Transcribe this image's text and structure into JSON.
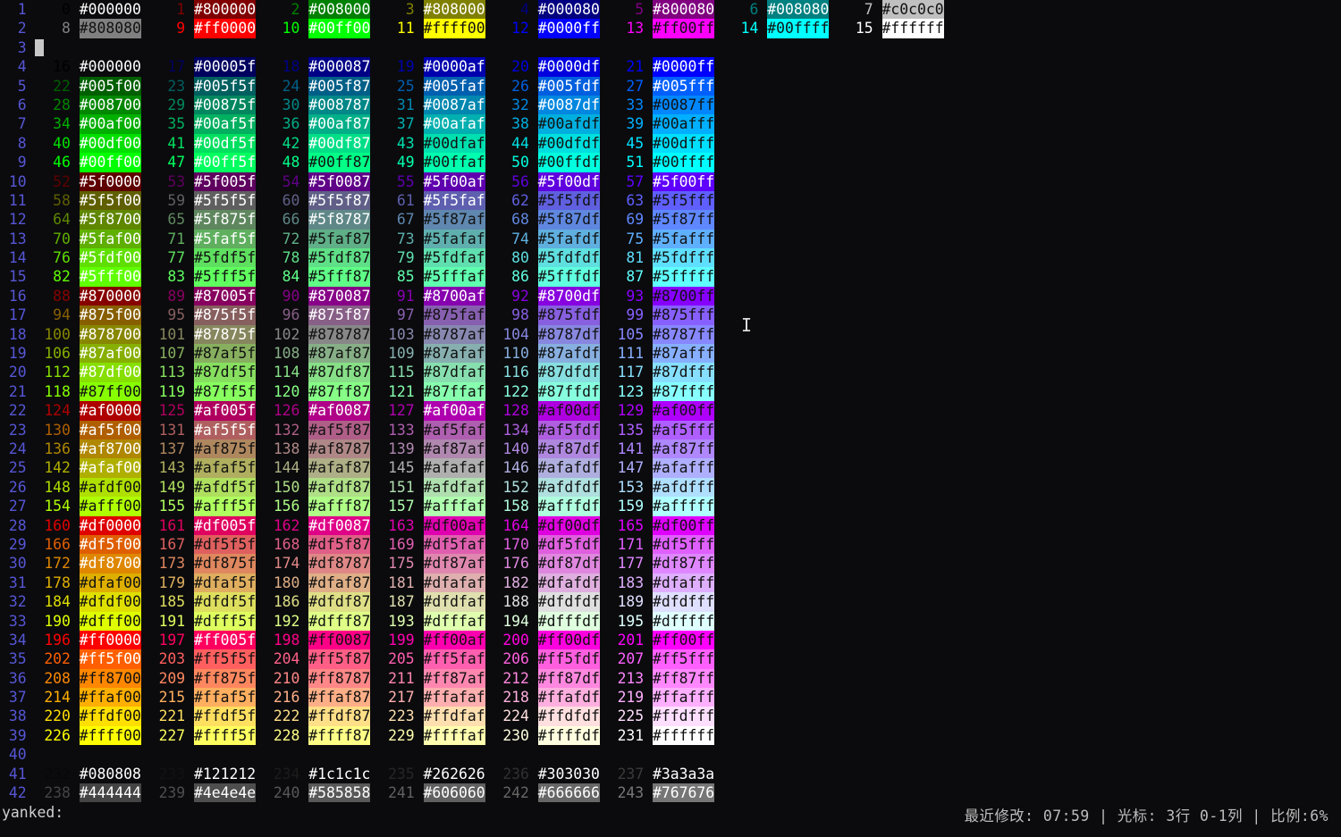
{
  "lines": [
    {
      "n": "1",
      "idx": [
        "0",
        "1",
        "2",
        "3",
        "4",
        "5",
        "6",
        "7"
      ],
      "hex": [
        "#000000",
        "#800000",
        "#008000",
        "#808000",
        "#000080",
        "#800080",
        "#008080",
        "#c0c0c0"
      ]
    },
    {
      "n": "2",
      "idx": [
        "8",
        "9",
        "10",
        "11",
        "12",
        "13",
        "14",
        "15"
      ],
      "hex": [
        "#808080",
        "#ff0000",
        "#00ff00",
        "#ffff00",
        "#0000ff",
        "#ff00ff",
        "#00ffff",
        "#ffffff"
      ]
    },
    {
      "n": "3",
      "idx": [],
      "hex": [],
      "cursor": true
    },
    {
      "n": "4",
      "idx": [
        "16",
        "17",
        "18",
        "19",
        "20",
        "21"
      ],
      "hex": [
        "#000000",
        "#00005f",
        "#000087",
        "#0000af",
        "#0000df",
        "#0000ff"
      ]
    },
    {
      "n": "5",
      "idx": [
        "22",
        "23",
        "24",
        "25",
        "26",
        "27"
      ],
      "hex": [
        "#005f00",
        "#005f5f",
        "#005f87",
        "#005faf",
        "#005fdf",
        "#005fff"
      ]
    },
    {
      "n": "6",
      "idx": [
        "28",
        "29",
        "30",
        "31",
        "32",
        "33"
      ],
      "hex": [
        "#008700",
        "#00875f",
        "#008787",
        "#0087af",
        "#0087df",
        "#0087ff"
      ]
    },
    {
      "n": "7",
      "idx": [
        "34",
        "35",
        "36",
        "37",
        "38",
        "39"
      ],
      "hex": [
        "#00af00",
        "#00af5f",
        "#00af87",
        "#00afaf",
        "#00afdf",
        "#00afff"
      ]
    },
    {
      "n": "8",
      "idx": [
        "40",
        "41",
        "42",
        "43",
        "44",
        "45"
      ],
      "hex": [
        "#00df00",
        "#00df5f",
        "#00df87",
        "#00dfaf",
        "#00dfdf",
        "#00dfff"
      ]
    },
    {
      "n": "9",
      "idx": [
        "46",
        "47",
        "48",
        "49",
        "50",
        "51"
      ],
      "hex": [
        "#00ff00",
        "#00ff5f",
        "#00ff87",
        "#00ffaf",
        "#00ffdf",
        "#00ffff"
      ]
    },
    {
      "n": "10",
      "idx": [
        "52",
        "53",
        "54",
        "55",
        "56",
        "57"
      ],
      "hex": [
        "#5f0000",
        "#5f005f",
        "#5f0087",
        "#5f00af",
        "#5f00df",
        "#5f00ff"
      ]
    },
    {
      "n": "11",
      "idx": [
        "58",
        "59",
        "60",
        "61",
        "62",
        "63"
      ],
      "hex": [
        "#5f5f00",
        "#5f5f5f",
        "#5f5f87",
        "#5f5faf",
        "#5f5fdf",
        "#5f5fff"
      ]
    },
    {
      "n": "12",
      "idx": [
        "64",
        "65",
        "66",
        "67",
        "68",
        "69"
      ],
      "hex": [
        "#5f8700",
        "#5f875f",
        "#5f8787",
        "#5f87af",
        "#5f87df",
        "#5f87ff"
      ]
    },
    {
      "n": "13",
      "idx": [
        "70",
        "71",
        "72",
        "73",
        "74",
        "75"
      ],
      "hex": [
        "#5faf00",
        "#5faf5f",
        "#5faf87",
        "#5fafaf",
        "#5fafdf",
        "#5fafff"
      ]
    },
    {
      "n": "14",
      "idx": [
        "76",
        "77",
        "78",
        "79",
        "80",
        "81"
      ],
      "hex": [
        "#5fdf00",
        "#5fdf5f",
        "#5fdf87",
        "#5fdfaf",
        "#5fdfdf",
        "#5fdfff"
      ]
    },
    {
      "n": "15",
      "idx": [
        "82",
        "83",
        "84",
        "85",
        "86",
        "87"
      ],
      "hex": [
        "#5fff00",
        "#5fff5f",
        "#5fff87",
        "#5fffaf",
        "#5fffdf",
        "#5fffff"
      ]
    },
    {
      "n": "16",
      "idx": [
        "88",
        "89",
        "90",
        "91",
        "92",
        "93"
      ],
      "hex": [
        "#870000",
        "#87005f",
        "#870087",
        "#8700af",
        "#8700df",
        "#8700ff"
      ]
    },
    {
      "n": "17",
      "idx": [
        "94",
        "95",
        "96",
        "97",
        "98",
        "99"
      ],
      "hex": [
        "#875f00",
        "#875f5f",
        "#875f87",
        "#875faf",
        "#875fdf",
        "#875fff"
      ]
    },
    {
      "n": "18",
      "idx": [
        "100",
        "101",
        "102",
        "103",
        "104",
        "105"
      ],
      "hex": [
        "#878700",
        "#87875f",
        "#878787",
        "#8787af",
        "#8787df",
        "#8787ff"
      ]
    },
    {
      "n": "19",
      "idx": [
        "106",
        "107",
        "108",
        "109",
        "110",
        "111"
      ],
      "hex": [
        "#87af00",
        "#87af5f",
        "#87af87",
        "#87afaf",
        "#87afdf",
        "#87afff"
      ]
    },
    {
      "n": "20",
      "idx": [
        "112",
        "113",
        "114",
        "115",
        "116",
        "117"
      ],
      "hex": [
        "#87df00",
        "#87df5f",
        "#87df87",
        "#87dfaf",
        "#87dfdf",
        "#87dfff"
      ]
    },
    {
      "n": "21",
      "idx": [
        "118",
        "119",
        "120",
        "121",
        "122",
        "123"
      ],
      "hex": [
        "#87ff00",
        "#87ff5f",
        "#87ff87",
        "#87ffaf",
        "#87ffdf",
        "#87ffff"
      ]
    },
    {
      "n": "22",
      "idx": [
        "124",
        "125",
        "126",
        "127",
        "128",
        "129"
      ],
      "hex": [
        "#af0000",
        "#af005f",
        "#af0087",
        "#af00af",
        "#af00df",
        "#af00ff"
      ]
    },
    {
      "n": "23",
      "idx": [
        "130",
        "131",
        "132",
        "133",
        "134",
        "135"
      ],
      "hex": [
        "#af5f00",
        "#af5f5f",
        "#af5f87",
        "#af5faf",
        "#af5fdf",
        "#af5fff"
      ]
    },
    {
      "n": "24",
      "idx": [
        "136",
        "137",
        "138",
        "139",
        "140",
        "141"
      ],
      "hex": [
        "#af8700",
        "#af875f",
        "#af8787",
        "#af87af",
        "#af87df",
        "#af87ff"
      ]
    },
    {
      "n": "25",
      "idx": [
        "142",
        "143",
        "144",
        "145",
        "146",
        "147"
      ],
      "hex": [
        "#afaf00",
        "#afaf5f",
        "#afaf87",
        "#afafaf",
        "#afafdf",
        "#afafff"
      ]
    },
    {
      "n": "26",
      "idx": [
        "148",
        "149",
        "150",
        "151",
        "152",
        "153"
      ],
      "hex": [
        "#afdf00",
        "#afdf5f",
        "#afdf87",
        "#afdfaf",
        "#afdfdf",
        "#afdfff"
      ]
    },
    {
      "n": "27",
      "idx": [
        "154",
        "155",
        "156",
        "157",
        "158",
        "159"
      ],
      "hex": [
        "#afff00",
        "#afff5f",
        "#afff87",
        "#afffaf",
        "#afffdf",
        "#afffff"
      ]
    },
    {
      "n": "28",
      "idx": [
        "160",
        "161",
        "162",
        "163",
        "164",
        "165"
      ],
      "hex": [
        "#df0000",
        "#df005f",
        "#df0087",
        "#df00af",
        "#df00df",
        "#df00ff"
      ]
    },
    {
      "n": "29",
      "idx": [
        "166",
        "167",
        "168",
        "169",
        "170",
        "171"
      ],
      "hex": [
        "#df5f00",
        "#df5f5f",
        "#df5f87",
        "#df5faf",
        "#df5fdf",
        "#df5fff"
      ]
    },
    {
      "n": "30",
      "idx": [
        "172",
        "173",
        "174",
        "175",
        "176",
        "177"
      ],
      "hex": [
        "#df8700",
        "#df875f",
        "#df8787",
        "#df87af",
        "#df87df",
        "#df87ff"
      ]
    },
    {
      "n": "31",
      "idx": [
        "178",
        "179",
        "180",
        "181",
        "182",
        "183"
      ],
      "hex": [
        "#dfaf00",
        "#dfaf5f",
        "#dfaf87",
        "#dfafaf",
        "#dfafdf",
        "#dfafff"
      ]
    },
    {
      "n": "32",
      "idx": [
        "184",
        "185",
        "186",
        "187",
        "188",
        "189"
      ],
      "hex": [
        "#dfdf00",
        "#dfdf5f",
        "#dfdf87",
        "#dfdfaf",
        "#dfdfdf",
        "#dfdfff"
      ]
    },
    {
      "n": "33",
      "idx": [
        "190",
        "191",
        "192",
        "193",
        "194",
        "195"
      ],
      "hex": [
        "#dfff00",
        "#dfff5f",
        "#dfff87",
        "#dfffaf",
        "#dfffdf",
        "#dfffff"
      ]
    },
    {
      "n": "34",
      "idx": [
        "196",
        "197",
        "198",
        "199",
        "200",
        "201"
      ],
      "hex": [
        "#ff0000",
        "#ff005f",
        "#ff0087",
        "#ff00af",
        "#ff00df",
        "#ff00ff"
      ]
    },
    {
      "n": "35",
      "idx": [
        "202",
        "203",
        "204",
        "205",
        "206",
        "207"
      ],
      "hex": [
        "#ff5f00",
        "#ff5f5f",
        "#ff5f87",
        "#ff5faf",
        "#ff5fdf",
        "#ff5fff"
      ]
    },
    {
      "n": "36",
      "idx": [
        "208",
        "209",
        "210",
        "211",
        "212",
        "213"
      ],
      "hex": [
        "#ff8700",
        "#ff875f",
        "#ff8787",
        "#ff87af",
        "#ff87df",
        "#ff87ff"
      ]
    },
    {
      "n": "37",
      "idx": [
        "214",
        "215",
        "216",
        "217",
        "218",
        "219"
      ],
      "hex": [
        "#ffaf00",
        "#ffaf5f",
        "#ffaf87",
        "#ffafaf",
        "#ffafdf",
        "#ffafff"
      ]
    },
    {
      "n": "38",
      "idx": [
        "220",
        "221",
        "222",
        "223",
        "224",
        "225"
      ],
      "hex": [
        "#ffdf00",
        "#ffdf5f",
        "#ffdf87",
        "#ffdfaf",
        "#ffdfdf",
        "#ffdfff"
      ]
    },
    {
      "n": "39",
      "idx": [
        "226",
        "227",
        "228",
        "229",
        "230",
        "231"
      ],
      "hex": [
        "#ffff00",
        "#ffff5f",
        "#ffff87",
        "#ffffaf",
        "#ffffdf",
        "#ffffff"
      ]
    },
    {
      "n": "40",
      "idx": [],
      "hex": []
    },
    {
      "n": "41",
      "idx": [
        "232",
        "233",
        "234",
        "235",
        "236",
        "237"
      ],
      "hex": [
        "#080808",
        "#121212",
        "#1c1c1c",
        "#262626",
        "#303030",
        "#3a3a3a"
      ]
    },
    {
      "n": "42",
      "idx": [
        "238",
        "239",
        "240",
        "241",
        "242",
        "243"
      ],
      "hex": [
        "#444444",
        "#4e4e4e",
        "#585858",
        "#606060",
        "#666666",
        "#767676"
      ]
    }
  ],
  "cmdline": "yanked:",
  "status": "最近修改: 07:59 | 光标: 3行 0-1列 | 比例:6%",
  "colors": {
    "line_number": "#5656d6",
    "background": "#0b0b0d",
    "cursor": "#c8c8c8"
  },
  "icons": {
    "mouse": "text-cursor-ibeam-icon"
  }
}
